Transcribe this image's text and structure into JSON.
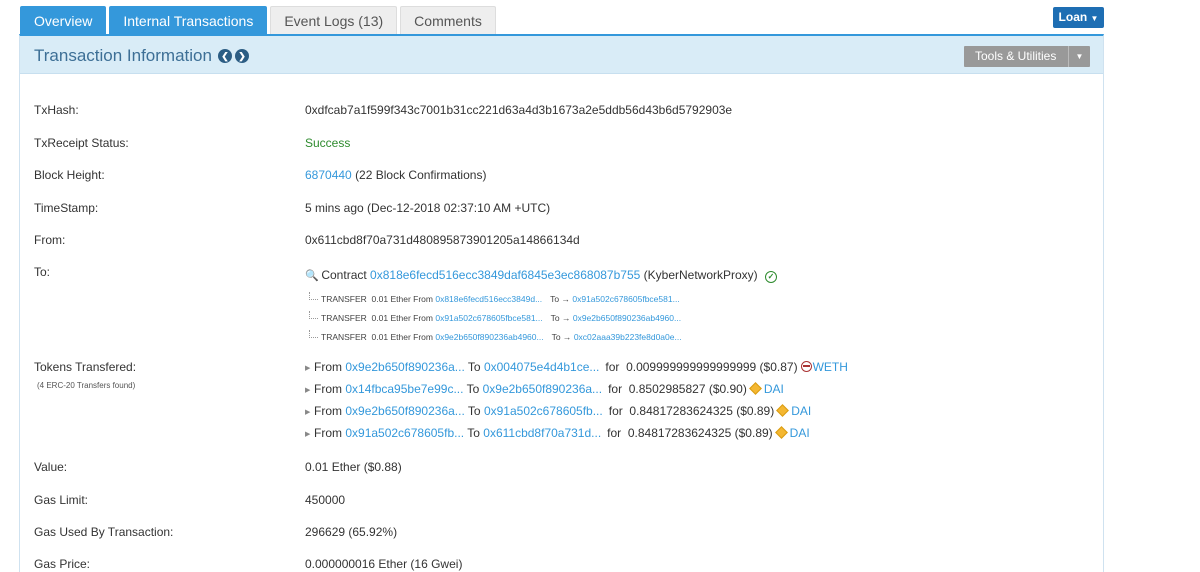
{
  "tabs": [
    {
      "label": "Overview"
    },
    {
      "label": "Internal Transactions"
    },
    {
      "label": "Event Logs (13)"
    },
    {
      "label": "Comments"
    }
  ],
  "loan_button": "Loan",
  "panel": {
    "title": "Transaction Information",
    "tools_label": "Tools & Utilities"
  },
  "tx": {
    "txhash_label": "TxHash:",
    "txhash": "0xdfcab7a1f599f343c7001b31cc221d63a4d3b1673a2e5ddb56d43b6d5792903e",
    "status_label": "TxReceipt Status:",
    "status": "Success",
    "block_label": "Block Height:",
    "block_number": "6870440",
    "block_confirmations": "(22 Block Confirmations)",
    "timestamp_label": "TimeStamp:",
    "timestamp": "5 mins ago (Dec-12-2018 02:37:10 AM +UTC)",
    "from_label": "From:",
    "from": "0x611cbd8f70a731d480895873901205a14866134d",
    "to_label": "To:",
    "to_prefix": "Contract",
    "to_address": "0x818e6fecd516ecc3849daf6845e3ec868087b755",
    "to_name": "(KyberNetworkProxy)",
    "internal_transfers": [
      {
        "kind": "TRANSFER",
        "amount": "0.01 Ether From",
        "from": "0x818e6fecd516ecc3849d...",
        "to_label": "To →",
        "to": "0x91a502c678605fbce581..."
      },
      {
        "kind": "TRANSFER",
        "amount": "0.01 Ether From",
        "from": "0x91a502c678605fbce581...",
        "to_label": "To →",
        "to": "0x9e2b650f890236ab4960..."
      },
      {
        "kind": "TRANSFER",
        "amount": "0.01 Ether From",
        "from": "0x9e2b650f890236ab4960...",
        "to_label": "To →",
        "to": "0xc02aaa39b223fe8d0a0e..."
      }
    ],
    "tokens_label": "Tokens Transfered:",
    "tokens_sub": "(4 ERC-20 Transfers found)",
    "token_transfers": [
      {
        "from_label": "From",
        "from": "0x9e2b650f890236a...",
        "to_label": "To",
        "to": "0x004075e4d4b1ce...",
        "for_label": "for",
        "amount": "0.009999999999999999 ($0.87)",
        "token": "WETH",
        "icon": "weth-icon"
      },
      {
        "from_label": "From",
        "from": "0x14fbca95be7e99c...",
        "to_label": "To",
        "to": "0x9e2b650f890236a...",
        "for_label": "for",
        "amount": "0.8502985827 ($0.90)",
        "token": "DAI",
        "icon": "dai-icon"
      },
      {
        "from_label": "From",
        "from": "0x9e2b650f890236a...",
        "to_label": "To",
        "to": "0x91a502c678605fb...",
        "for_label": "for",
        "amount": "0.84817283624325 ($0.89)",
        "token": "DAI",
        "icon": "dai-icon"
      },
      {
        "from_label": "From",
        "from": "0x91a502c678605fb...",
        "to_label": "To",
        "to": "0x611cbd8f70a731d...",
        "for_label": "for",
        "amount": "0.84817283624325 ($0.89)",
        "token": "DAI",
        "icon": "dai-icon"
      }
    ],
    "value_label": "Value:",
    "value": "0.01 Ether ($0.88)",
    "gas_limit_label": "Gas Limit:",
    "gas_limit": "450000",
    "gas_used_label": "Gas Used By Transaction:",
    "gas_used": "296629 (65.92%)",
    "gas_price_label": "Gas Price:",
    "gas_price": "0.000000016 Ether (16 Gwei)"
  },
  "colors": {
    "accent": "#3498db",
    "success": "#2e8b2e",
    "panel_header": "#d9ecf7"
  }
}
